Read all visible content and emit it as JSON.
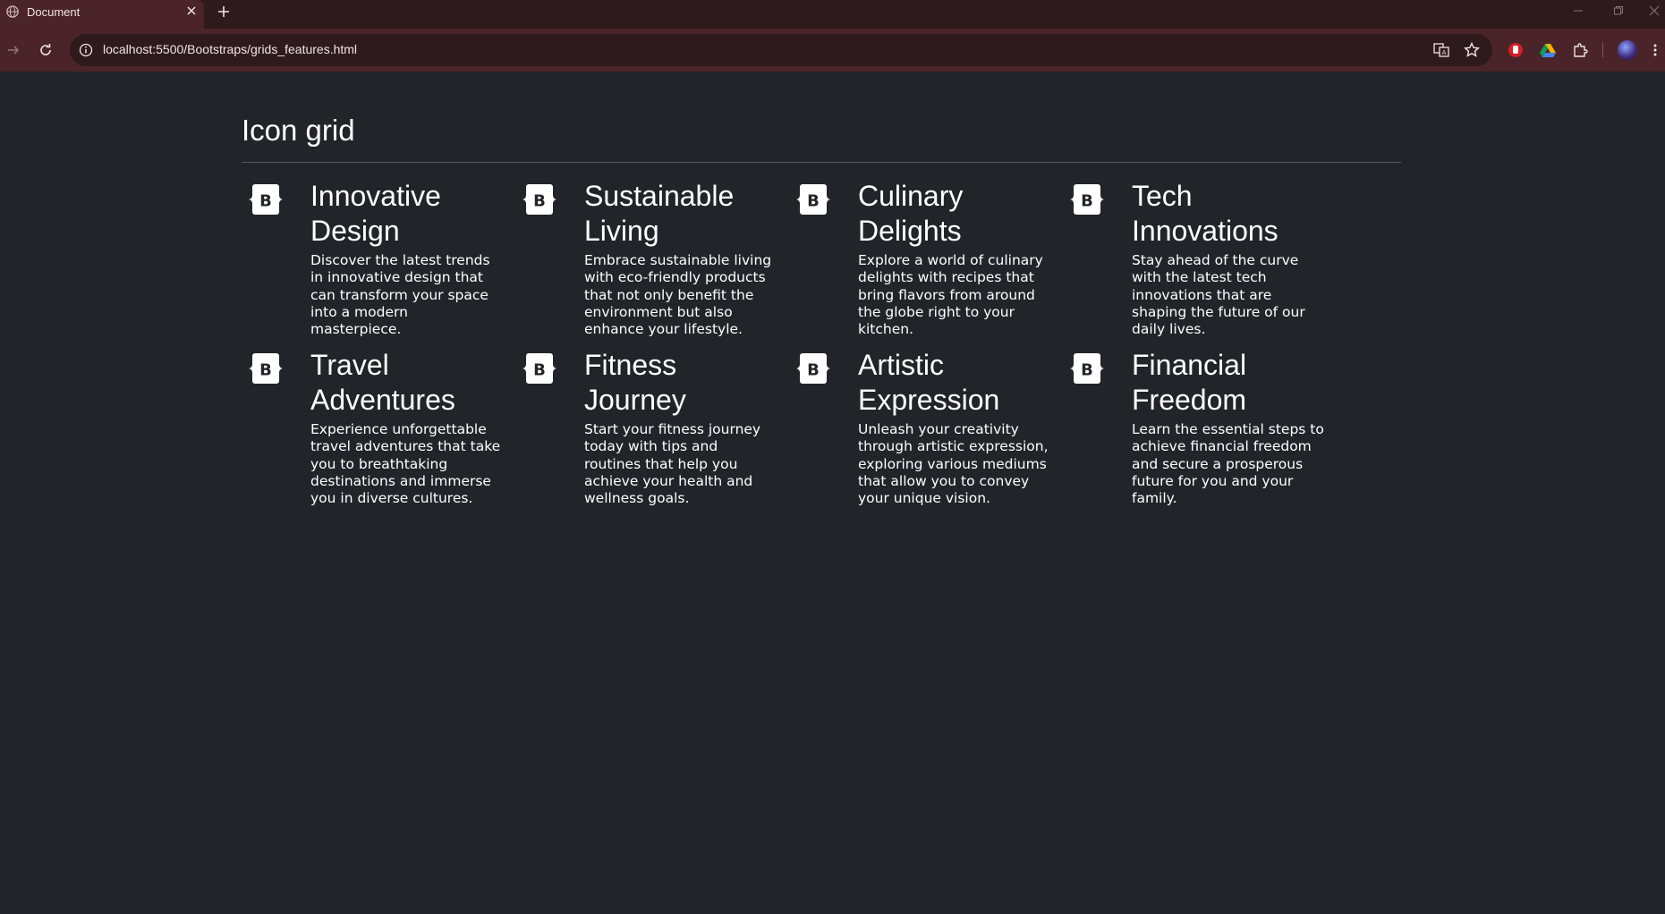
{
  "browser": {
    "tab_title": "Document",
    "url": "localhost:5500/Bootstraps/grids_features.html",
    "icons": [
      "globe-icon",
      "close-icon",
      "plus-icon",
      "minimize-icon",
      "restore-icon",
      "close-window-icon",
      "back-icon",
      "forward-icon",
      "reload-icon",
      "info-icon",
      "translate-icon",
      "star-icon",
      "stop-extension-icon",
      "drive-icon",
      "puzzle-icon",
      "avatar",
      "menu-icon"
    ]
  },
  "page": {
    "title": "Icon grid",
    "background": "#212529",
    "features": [
      {
        "icon": "bootstrap-icon",
        "title": "Innovative Design",
        "description": "Discover the latest trends in innovative design that can transform your space into a modern masterpiece."
      },
      {
        "icon": "bootstrap-icon",
        "title": "Sustainable Living",
        "description": "Embrace sustainable living with eco-friendly products that not only benefit the environment but also enhance your lifestyle."
      },
      {
        "icon": "bootstrap-icon",
        "title": "Culinary Delights",
        "description": "Explore a world of culinary delights with recipes that bring flavors from around the globe right to your kitchen."
      },
      {
        "icon": "bootstrap-icon",
        "title": "Tech Innovations",
        "description": "Stay ahead of the curve with the latest tech innovations that are shaping the future of our daily lives."
      },
      {
        "icon": "bootstrap-icon",
        "title": "Travel Adventures",
        "description": "Experience unforgettable travel adventures that take you to breathtaking destinations and immerse you in diverse cultures."
      },
      {
        "icon": "bootstrap-icon",
        "title": "Fitness Journey",
        "description": "Start your fitness journey today with tips and routines that help you achieve your health and wellness goals."
      },
      {
        "icon": "bootstrap-icon",
        "title": "Artistic Expression",
        "description": "Unleash your creativity through artistic expression, exploring various mediums that allow you to convey your unique vision."
      },
      {
        "icon": "bootstrap-icon",
        "title": "Financial Freedom",
        "description": "Learn the essential steps to achieve financial freedom and secure a prosperous future for you and your family."
      }
    ]
  }
}
